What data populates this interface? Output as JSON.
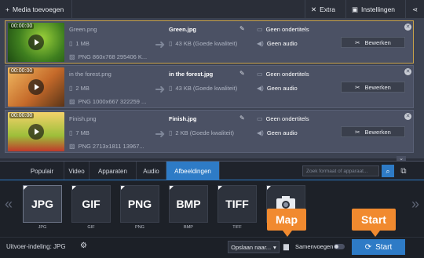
{
  "topbar": {
    "add_label": "Media toevoegen",
    "extra_label": "Extra",
    "settings_label": "Instellingen"
  },
  "files": [
    {
      "timecode": "00:00:00",
      "name": "Green.png",
      "size": "1 MB",
      "info": "PNG 860x768 295406 K...",
      "out_name": "Green.jpg",
      "out_size": "43 KB (Goede kwaliteit)",
      "subtitles": "Geen ondertitels",
      "audio": "Geen audio",
      "edit_label": "Bewerken",
      "thumb_colors": [
        "#3f7f1f",
        "#9bd13a",
        "#1e4b12"
      ]
    },
    {
      "timecode": "00:00:00",
      "name": "in the forest.png",
      "size": "2 MB",
      "info": "PNG 1000x667 322259 ...",
      "out_name": "in the forest.jpg",
      "out_size": "43 KB (Goede kwaliteit)",
      "subtitles": "Geen ondertitels",
      "audio": "Geen audio",
      "edit_label": "Bewerken",
      "thumb_colors": [
        "#c56a2a",
        "#f0b860",
        "#5a3418"
      ]
    },
    {
      "timecode": "00:00:00",
      "name": "Finish.png",
      "size": "7 MB",
      "info": "PNG 2713x1811 13967...",
      "out_name": "Finish.jpg",
      "out_size": "2 KB (Goede kwaliteit)",
      "subtitles": "Geen ondertitels",
      "audio": "Geen audio",
      "edit_label": "Bewerken",
      "thumb_colors": [
        "#9dbf3a",
        "#f4d26a",
        "#c0392b"
      ]
    }
  ],
  "tabs": [
    "Populair",
    "Video",
    "Apparaten",
    "Audio",
    "Afbeeldingen"
  ],
  "active_tab": "Afbeeldingen",
  "search": {
    "placeholder": "Zoek formaat of apparaat..."
  },
  "formats": [
    {
      "box": "JPG",
      "label": "JPG"
    },
    {
      "box": "GIF",
      "label": "GIF"
    },
    {
      "box": "PNG",
      "label": "PNG"
    },
    {
      "box": "BMP",
      "label": "BMP"
    },
    {
      "box": "TIFF",
      "label": "TIFF"
    },
    {
      "box": "",
      "label": ""
    }
  ],
  "bottom": {
    "output_format": "Uitvoer-indeling: JPG",
    "save_to": "Opslaan naar...",
    "merge": "Samenvoegen",
    "start": "Start"
  },
  "callouts": {
    "map": "Map",
    "start": "Start"
  },
  "colors": {
    "accent": "#2e7bc6",
    "callout": "#f18a2f",
    "selected_border": "#c8a24a"
  }
}
